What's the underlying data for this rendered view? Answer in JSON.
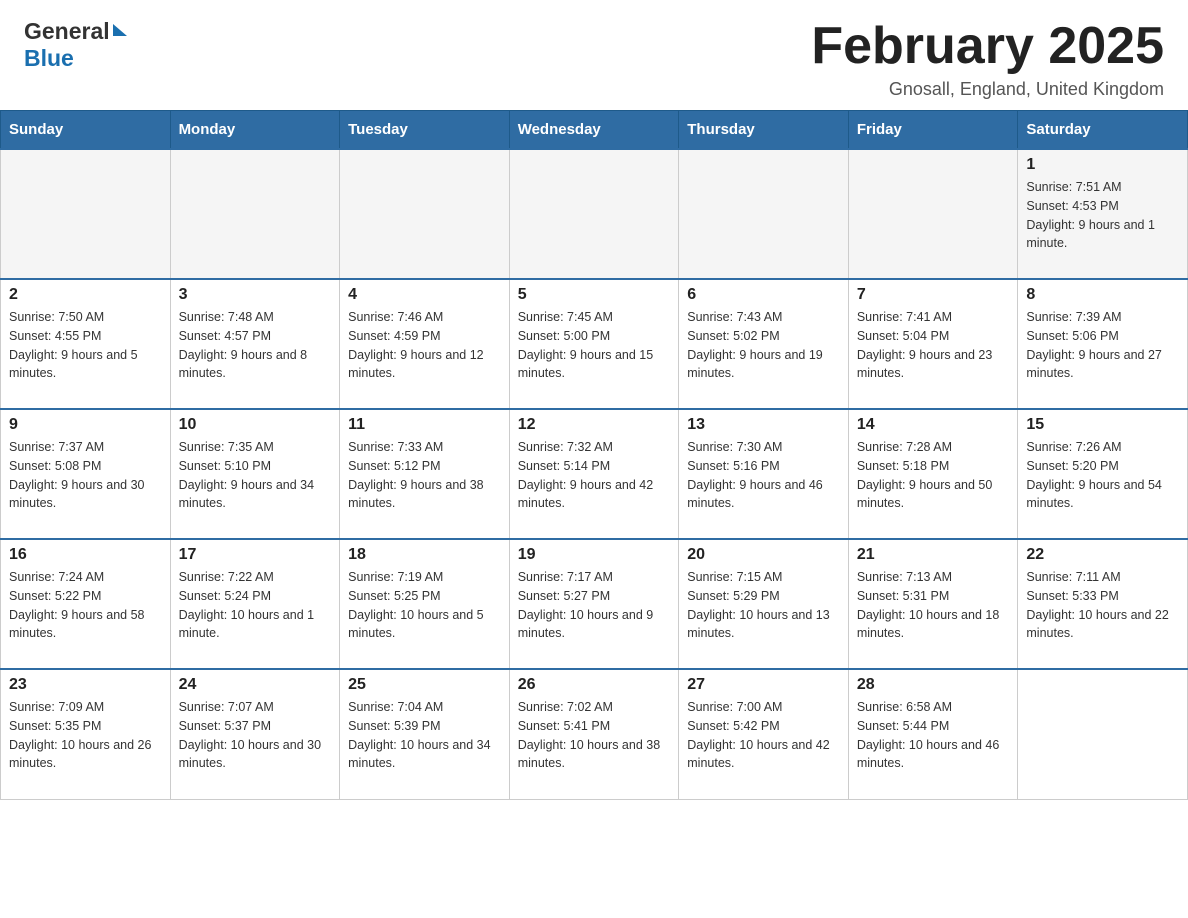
{
  "header": {
    "logo_general": "General",
    "logo_blue": "Blue",
    "month_title": "February 2025",
    "location": "Gnosall, England, United Kingdom"
  },
  "calendar": {
    "days_of_week": [
      "Sunday",
      "Monday",
      "Tuesday",
      "Wednesday",
      "Thursday",
      "Friday",
      "Saturday"
    ],
    "weeks": [
      [
        {
          "day": "",
          "info": ""
        },
        {
          "day": "",
          "info": ""
        },
        {
          "day": "",
          "info": ""
        },
        {
          "day": "",
          "info": ""
        },
        {
          "day": "",
          "info": ""
        },
        {
          "day": "",
          "info": ""
        },
        {
          "day": "1",
          "info": "Sunrise: 7:51 AM\nSunset: 4:53 PM\nDaylight: 9 hours and 1 minute."
        }
      ],
      [
        {
          "day": "2",
          "info": "Sunrise: 7:50 AM\nSunset: 4:55 PM\nDaylight: 9 hours and 5 minutes."
        },
        {
          "day": "3",
          "info": "Sunrise: 7:48 AM\nSunset: 4:57 PM\nDaylight: 9 hours and 8 minutes."
        },
        {
          "day": "4",
          "info": "Sunrise: 7:46 AM\nSunset: 4:59 PM\nDaylight: 9 hours and 12 minutes."
        },
        {
          "day": "5",
          "info": "Sunrise: 7:45 AM\nSunset: 5:00 PM\nDaylight: 9 hours and 15 minutes."
        },
        {
          "day": "6",
          "info": "Sunrise: 7:43 AM\nSunset: 5:02 PM\nDaylight: 9 hours and 19 minutes."
        },
        {
          "day": "7",
          "info": "Sunrise: 7:41 AM\nSunset: 5:04 PM\nDaylight: 9 hours and 23 minutes."
        },
        {
          "day": "8",
          "info": "Sunrise: 7:39 AM\nSunset: 5:06 PM\nDaylight: 9 hours and 27 minutes."
        }
      ],
      [
        {
          "day": "9",
          "info": "Sunrise: 7:37 AM\nSunset: 5:08 PM\nDaylight: 9 hours and 30 minutes."
        },
        {
          "day": "10",
          "info": "Sunrise: 7:35 AM\nSunset: 5:10 PM\nDaylight: 9 hours and 34 minutes."
        },
        {
          "day": "11",
          "info": "Sunrise: 7:33 AM\nSunset: 5:12 PM\nDaylight: 9 hours and 38 minutes."
        },
        {
          "day": "12",
          "info": "Sunrise: 7:32 AM\nSunset: 5:14 PM\nDaylight: 9 hours and 42 minutes."
        },
        {
          "day": "13",
          "info": "Sunrise: 7:30 AM\nSunset: 5:16 PM\nDaylight: 9 hours and 46 minutes."
        },
        {
          "day": "14",
          "info": "Sunrise: 7:28 AM\nSunset: 5:18 PM\nDaylight: 9 hours and 50 minutes."
        },
        {
          "day": "15",
          "info": "Sunrise: 7:26 AM\nSunset: 5:20 PM\nDaylight: 9 hours and 54 minutes."
        }
      ],
      [
        {
          "day": "16",
          "info": "Sunrise: 7:24 AM\nSunset: 5:22 PM\nDaylight: 9 hours and 58 minutes."
        },
        {
          "day": "17",
          "info": "Sunrise: 7:22 AM\nSunset: 5:24 PM\nDaylight: 10 hours and 1 minute."
        },
        {
          "day": "18",
          "info": "Sunrise: 7:19 AM\nSunset: 5:25 PM\nDaylight: 10 hours and 5 minutes."
        },
        {
          "day": "19",
          "info": "Sunrise: 7:17 AM\nSunset: 5:27 PM\nDaylight: 10 hours and 9 minutes."
        },
        {
          "day": "20",
          "info": "Sunrise: 7:15 AM\nSunset: 5:29 PM\nDaylight: 10 hours and 13 minutes."
        },
        {
          "day": "21",
          "info": "Sunrise: 7:13 AM\nSunset: 5:31 PM\nDaylight: 10 hours and 18 minutes."
        },
        {
          "day": "22",
          "info": "Sunrise: 7:11 AM\nSunset: 5:33 PM\nDaylight: 10 hours and 22 minutes."
        }
      ],
      [
        {
          "day": "23",
          "info": "Sunrise: 7:09 AM\nSunset: 5:35 PM\nDaylight: 10 hours and 26 minutes."
        },
        {
          "day": "24",
          "info": "Sunrise: 7:07 AM\nSunset: 5:37 PM\nDaylight: 10 hours and 30 minutes."
        },
        {
          "day": "25",
          "info": "Sunrise: 7:04 AM\nSunset: 5:39 PM\nDaylight: 10 hours and 34 minutes."
        },
        {
          "day": "26",
          "info": "Sunrise: 7:02 AM\nSunset: 5:41 PM\nDaylight: 10 hours and 38 minutes."
        },
        {
          "day": "27",
          "info": "Sunrise: 7:00 AM\nSunset: 5:42 PM\nDaylight: 10 hours and 42 minutes."
        },
        {
          "day": "28",
          "info": "Sunrise: 6:58 AM\nSunset: 5:44 PM\nDaylight: 10 hours and 46 minutes."
        },
        {
          "day": "",
          "info": ""
        }
      ]
    ]
  }
}
